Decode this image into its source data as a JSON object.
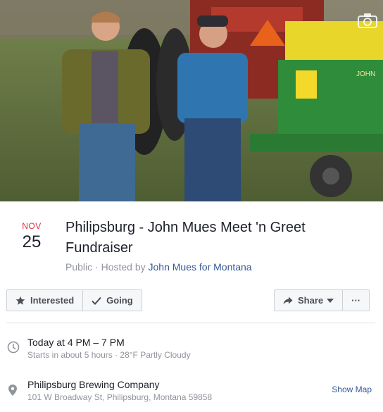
{
  "event": {
    "month": "NOV",
    "day": "25",
    "title": "Philipsburg - John Mues Meet 'n Greet Fundraiser",
    "visibility": "Public",
    "hosted_prefix": " · Hosted by ",
    "host": "John Mues for Montana"
  },
  "cover": {
    "icon": "camera-icon",
    "tractor_label": "JOHN"
  },
  "actions": {
    "interested": "Interested",
    "going": "Going",
    "share": "Share",
    "more": "···"
  },
  "time": {
    "main": "Today at 4 PM – 7 PM",
    "sub": "Starts in about 5 hours · 28°F Partly Cloudy"
  },
  "location": {
    "name": "Philipsburg Brewing Company",
    "address": "101 W Broadway St, Philipsburg, Montana 59858",
    "show_map": "Show Map"
  },
  "colors": {
    "month_red": "#e02f3e",
    "link_blue": "#365899",
    "secondary_gray": "#90949c"
  }
}
